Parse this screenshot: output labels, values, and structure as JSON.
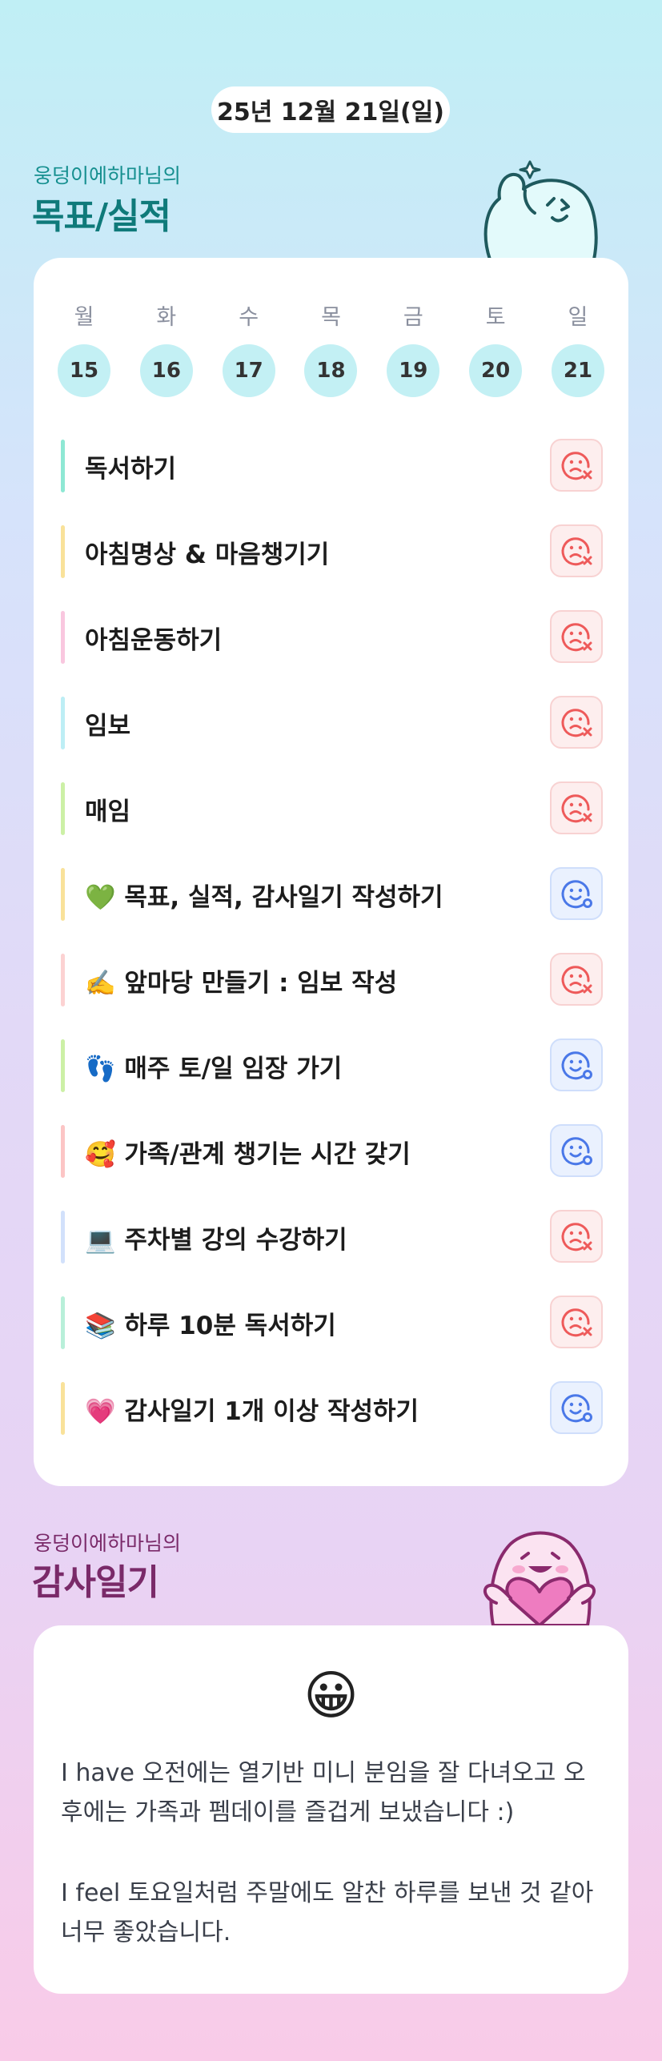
{
  "header": {
    "date": "25년 12월 21일(일)"
  },
  "goals": {
    "owner": "웅덩이에하마님의",
    "title": "목표/실적",
    "week": {
      "days": [
        "월",
        "화",
        "수",
        "목",
        "금",
        "토",
        "일"
      ],
      "dates": [
        "15",
        "16",
        "17",
        "18",
        "19",
        "20",
        "21"
      ]
    },
    "items": [
      {
        "text": "독서하기",
        "bar_color": "#8ee8d4",
        "status": "fail",
        "status_icon": "sad-face-x-icon"
      },
      {
        "text": "아침명상 & 마음챙기기",
        "bar_color": "#f9e29a",
        "status": "fail",
        "status_icon": "sad-face-x-icon"
      },
      {
        "text": "아침운동하기",
        "bar_color": "#f9c7df",
        "status": "fail",
        "status_icon": "sad-face-x-icon"
      },
      {
        "text": "임보",
        "bar_color": "#bdeef5",
        "status": "fail",
        "status_icon": "sad-face-x-icon"
      },
      {
        "text": "매임",
        "bar_color": "#ccf0a6",
        "status": "fail",
        "status_icon": "sad-face-x-icon"
      },
      {
        "text": "💚 목표, 실적, 감사일기 작성하기",
        "bar_color": "#f9e29a",
        "status": "done",
        "status_icon": "smile-face-o-icon"
      },
      {
        "text": "✍️ 앞마당 만들기 : 임보 작성",
        "bar_color": "#fcd2d2",
        "status": "fail",
        "status_icon": "sad-face-x-icon"
      },
      {
        "text": "👣 매주 토/일 임장 가기",
        "bar_color": "#ccf0a6",
        "status": "done",
        "status_icon": "smile-face-o-icon"
      },
      {
        "text": "🥰 가족/관계 챙기는 시간 갖기",
        "bar_color": "#fcc5c5",
        "status": "done",
        "status_icon": "smile-face-o-icon"
      },
      {
        "text": "💻 주차별 강의 수강하기",
        "bar_color": "#d2e1fb",
        "status": "fail",
        "status_icon": "sad-face-x-icon"
      },
      {
        "text": "📚 하루 10분 독서하기",
        "bar_color": "#b8efd9",
        "status": "fail",
        "status_icon": "sad-face-x-icon"
      },
      {
        "text": "💗 감사일기 1개 이상 작성하기",
        "bar_color": "#f9e29a",
        "status": "done",
        "status_icon": "smile-face-o-icon"
      }
    ],
    "colors": {
      "fail": "#ee5a5a",
      "done": "#4a78e8"
    }
  },
  "gratitude": {
    "owner": "웅덩이에하마님의",
    "title": "감사일기",
    "emoji": "😀",
    "paragraphs": [
      "I have 오전에는 열기반 미니 분임을 잘 다녀오고 오후에는 가족과 펨데이를 즐겁게 보냈습니다 :)",
      "I feel 토요일처럼 주말에도 알찬 하루를 보낸 것 같아 너무 좋았습니다."
    ]
  }
}
